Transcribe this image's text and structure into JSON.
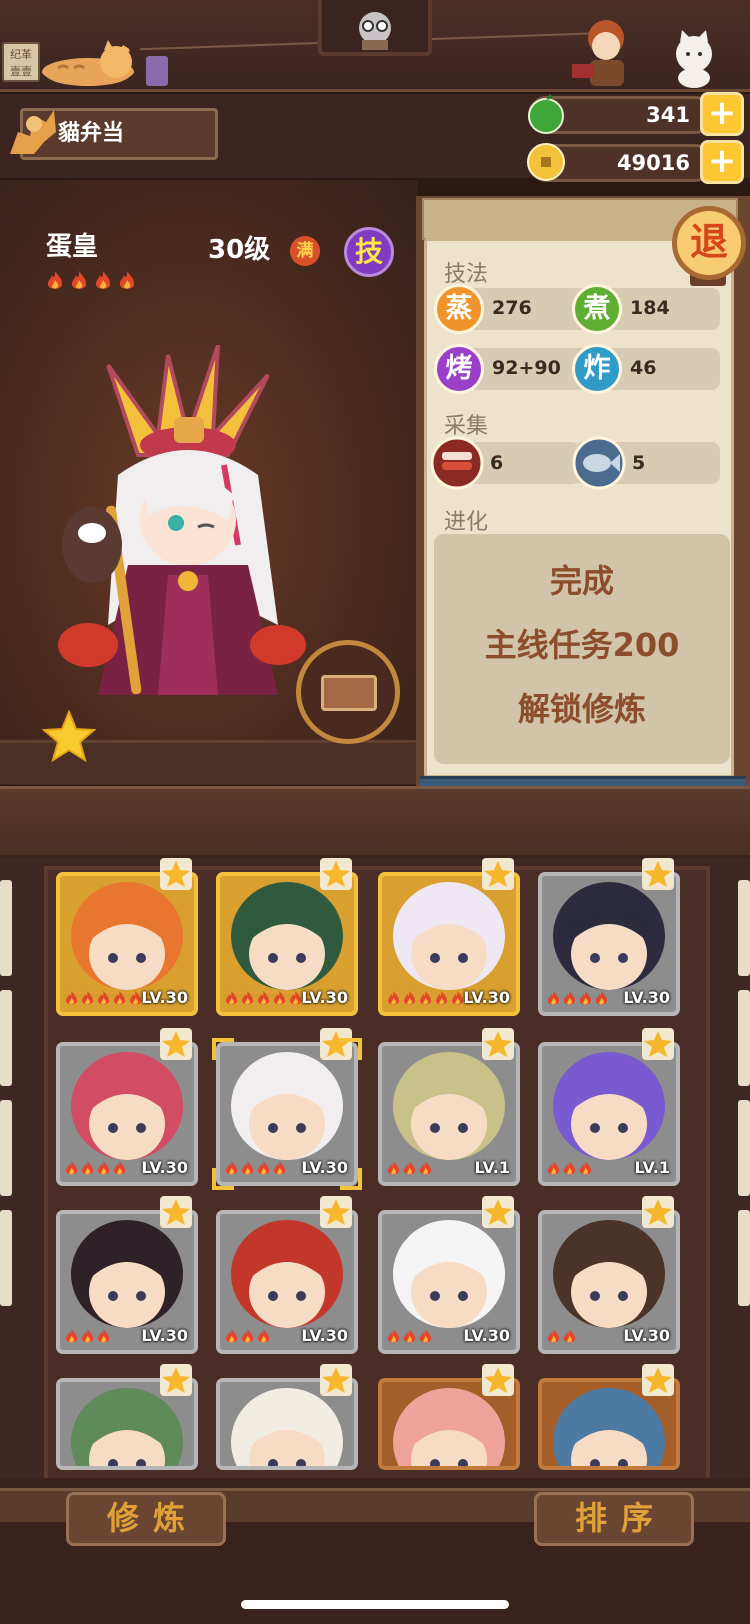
{
  "header": {
    "sign_text": "纪革 壹壹",
    "player_name": "貓弁当",
    "resources": [
      {
        "name": "vegetable",
        "value": "341",
        "icon": "green-vegetable-icon",
        "color": "#3fa63a"
      },
      {
        "name": "coin",
        "value": "49016",
        "icon": "coin-icon",
        "color": "#f2c23a"
      }
    ]
  },
  "hero": {
    "name": "蛋皇",
    "level": "30级",
    "max_badge": "满",
    "skill_badge": "技",
    "flame_count": 4,
    "star_icon": "star-icon"
  },
  "panel": {
    "skills_title": "技法",
    "skills": [
      {
        "label": "蒸",
        "value": "276",
        "color": "#f0932b"
      },
      {
        "label": "煮",
        "value": "184",
        "color": "#5fae33"
      },
      {
        "label": "烤",
        "value": "92+90",
        "color": "#9a3fc9"
      },
      {
        "label": "炸",
        "value": "46",
        "color": "#2f9bc6"
      }
    ],
    "gather_title": "采集",
    "gather": [
      {
        "icon": "meat-icon",
        "value": "6"
      },
      {
        "icon": "fish-icon",
        "value": "5"
      }
    ],
    "evolution_title": "进化",
    "evolution_lines": [
      "完成",
      "主线任务200",
      "解锁修炼"
    ],
    "exit_label": "退"
  },
  "roster": [
    {
      "tier": "gold",
      "level": "LV.30",
      "flames": 5,
      "hair": "#e8762f",
      "skin": "#f7dcc5"
    },
    {
      "tier": "gold",
      "level": "LV.30",
      "flames": 5,
      "hair": "#2f5a3d",
      "skin": "#f7dcc5"
    },
    {
      "tier": "gold",
      "level": "LV.30",
      "flames": 5,
      "hair": "#efe8f4",
      "skin": "#f7dcc5"
    },
    {
      "tier": "grey",
      "level": "LV.30",
      "flames": 4,
      "hair": "#2c2a3d",
      "skin": "#f7dcc5"
    },
    {
      "tier": "grey",
      "level": "LV.30",
      "flames": 4,
      "hair": "#d24c63",
      "skin": "#f7dcc5"
    },
    {
      "tier": "grey",
      "level": "LV.30",
      "flames": 4,
      "hair": "#f2eef0",
      "skin": "#f7dcc5",
      "selected": true
    },
    {
      "tier": "grey",
      "level": "LV.1",
      "flames": 3,
      "hair": "#c8c28a",
      "skin": "#f7dcc5"
    },
    {
      "tier": "grey",
      "level": "LV.1",
      "flames": 3,
      "hair": "#7a5ad0",
      "skin": "#f7dcc5"
    },
    {
      "tier": "grey",
      "level": "LV.30",
      "flames": 3,
      "hair": "#2e2228",
      "skin": "#f7dcc5"
    },
    {
      "tier": "grey",
      "level": "LV.30",
      "flames": 3,
      "hair": "#c3372a",
      "skin": "#f7dcc5"
    },
    {
      "tier": "grey",
      "level": "LV.30",
      "flames": 3,
      "hair": "#f4f4f4",
      "skin": "#f7dcc5"
    },
    {
      "tier": "grey",
      "level": "LV.30",
      "flames": 2,
      "hair": "#4a3328",
      "skin": "#f7dcc5"
    },
    {
      "tier": "grey",
      "level": "",
      "flames": 0,
      "hair": "#5f8a59",
      "skin": "#f7dcc5"
    },
    {
      "tier": "grey",
      "level": "",
      "flames": 0,
      "hair": "#f2ede3",
      "skin": "#f7dcc5"
    },
    {
      "tier": "orange",
      "level": "",
      "flames": 0,
      "hair": "#f0a39a",
      "skin": "#f7dcc5"
    },
    {
      "tier": "orange",
      "level": "",
      "flames": 0,
      "hair": "#4d7aa3",
      "skin": "#f7dcc5"
    }
  ],
  "buttons": {
    "cultivate": "修炼",
    "sort": "排序"
  }
}
